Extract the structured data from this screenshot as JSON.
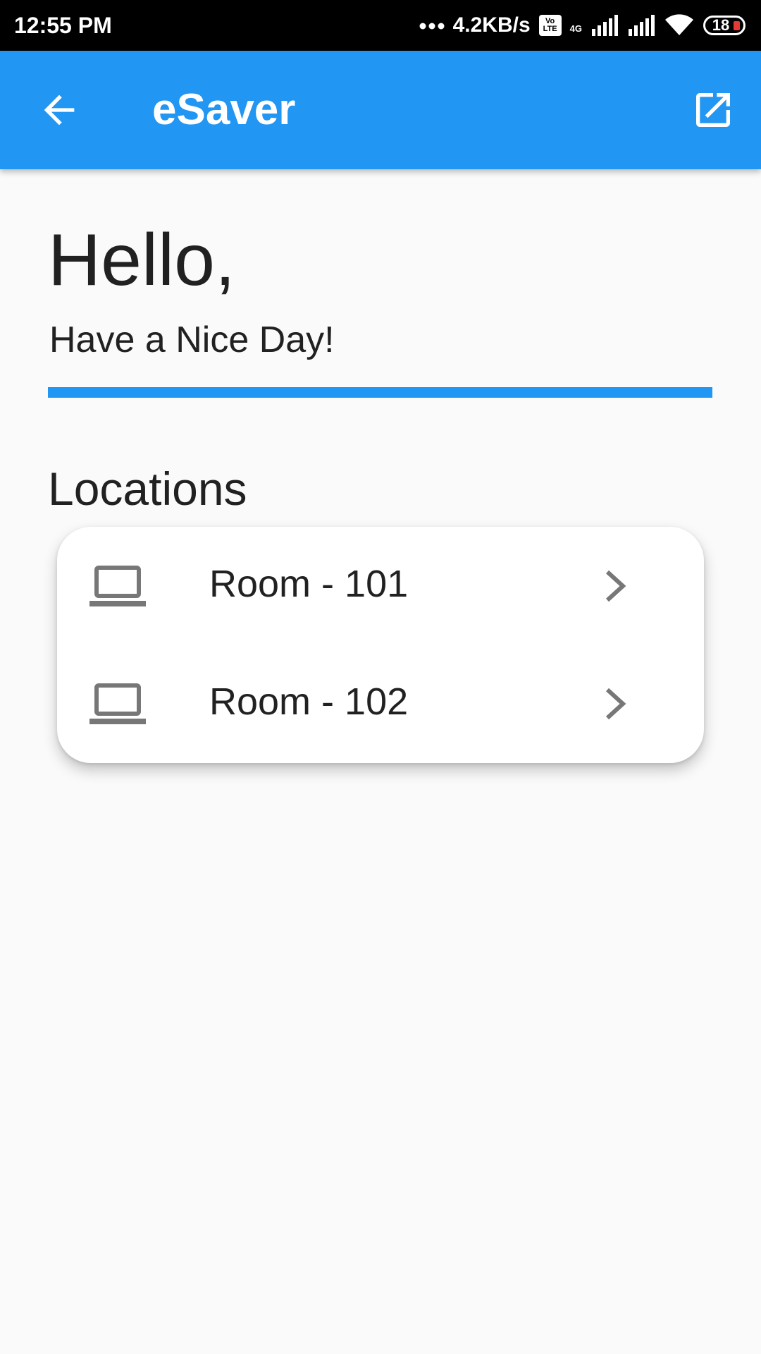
{
  "status_bar": {
    "time": "12:55 PM",
    "net_speed": "4.2KB/s",
    "volte_top": "Vo",
    "volte_bottom": "LTE",
    "network": "4G",
    "battery": "18"
  },
  "app_bar": {
    "title": "eSaver",
    "color": "#2196f3",
    "back_icon": "arrow-left-icon",
    "action_icon": "open-in-new-icon"
  },
  "greeting": {
    "title": "Hello,",
    "subtitle": "Have a Nice Day!"
  },
  "locations": {
    "title": "Locations",
    "items": [
      {
        "icon": "laptop-icon",
        "label": "Room - 101"
      },
      {
        "icon": "laptop-icon",
        "label": "Room - 102"
      }
    ]
  }
}
